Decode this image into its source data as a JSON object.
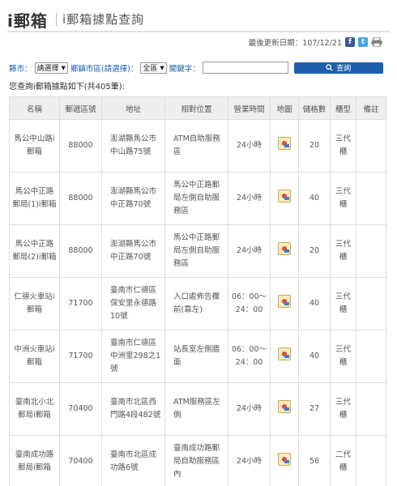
{
  "header": {
    "brand": "i郵箱",
    "subtitle": "i郵箱據點查詢"
  },
  "updated": {
    "label": "最後更新日期：107/12/21",
    "icons": [
      "facebook-icon",
      "twitter-icon",
      "print-icon"
    ]
  },
  "filters": {
    "city_label": "縣市：",
    "city_value": "請選擇",
    "district_label": "鄉鎮市區(請選擇)：",
    "district_value": "全區",
    "keyword_label": "關鍵字：",
    "keyword_value": "",
    "search_label": "查詢"
  },
  "result_text": "您查詢i郵箱據點如下(共405筆):",
  "table": {
    "headers": [
      "名稱",
      "郵遞區號",
      "地址",
      "相對位置",
      "營業時間",
      "地圖",
      "儲格數",
      "櫃型",
      "備註"
    ],
    "rows": [
      {
        "name": "馬公中山路i郵箱",
        "zip": "88000",
        "address": "澎湖縣馬公市中山路75號",
        "position": "ATM自助服務區",
        "hours": "24小時",
        "cells": "20",
        "type": "三代櫃",
        "note": ""
      },
      {
        "name": "馬公中正路郵局(1)i郵箱",
        "zip": "88000",
        "address": "澎湖縣馬公市中正路70號",
        "position": "馬公中正路郵局左側自助服務區",
        "hours": "24小時",
        "cells": "40",
        "type": "三代櫃",
        "note": ""
      },
      {
        "name": "馬公中正路郵局(2)i郵箱",
        "zip": "88000",
        "address": "澎湖縣馬公市中正路70號",
        "position": "馬公中正路郵局左側自助服務區",
        "hours": "24小時",
        "cells": "20",
        "type": "三代櫃",
        "note": ""
      },
      {
        "name": "仁德火車站i郵箱",
        "zip": "71700",
        "address": "臺南市仁德區保安里永德路10號",
        "position": "入口處佈告欄前(靠左)",
        "hours": "06：00～24：00",
        "cells": "40",
        "type": "三代櫃",
        "note": ""
      },
      {
        "name": "中洲火車站i郵箱",
        "zip": "71700",
        "address": "臺南市仁德區中洲里298之1號",
        "position": "站長室左側牆面",
        "hours": "06：00～24：00",
        "cells": "40",
        "type": "三代櫃",
        "note": ""
      },
      {
        "name": "臺南北小北郵局i郵箱",
        "zip": "70400",
        "address": "臺南市北區西門路4段482號",
        "position": "ATM服務區左側",
        "hours": "24小時",
        "cells": "27",
        "type": "三代櫃",
        "note": ""
      },
      {
        "name": "臺南成功路郵局i郵箱",
        "zip": "70400",
        "address": "臺南市北區成功路6號",
        "position": "臺南成功路郵局自助服務區內",
        "hours": "24小時",
        "cells": "56",
        "type": "二代櫃",
        "note": ""
      }
    ]
  }
}
